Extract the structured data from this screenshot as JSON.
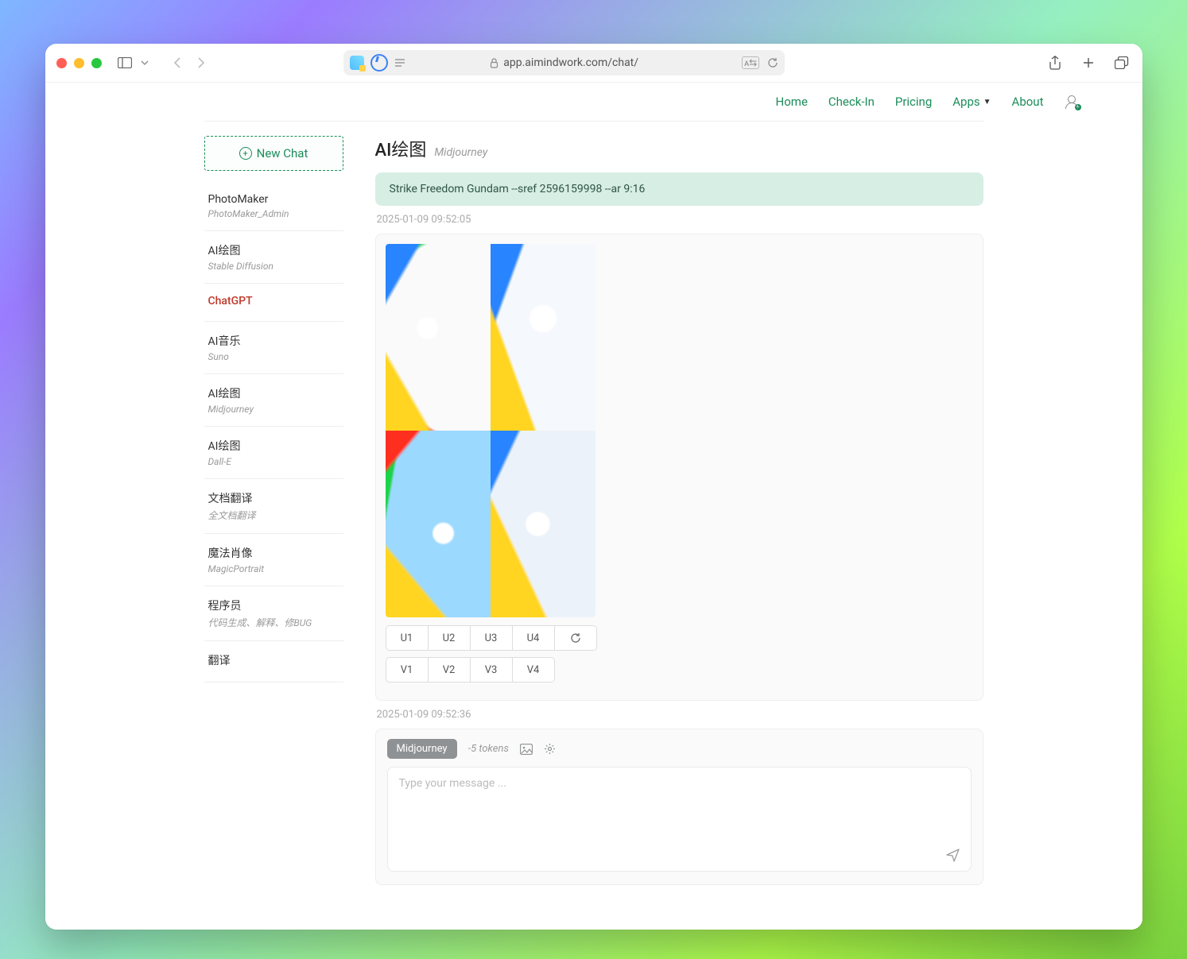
{
  "browser": {
    "url": "app.aimindwork.com/chat/"
  },
  "nav": {
    "home": "Home",
    "checkin": "Check-In",
    "pricing": "Pricing",
    "apps": "Apps",
    "about": "About"
  },
  "sidebar": {
    "new_chat": "New Chat",
    "items": [
      {
        "t": "PhotoMaker",
        "s": "PhotoMaker_Admin"
      },
      {
        "t": "AI绘图",
        "s": "Stable Diffusion"
      },
      {
        "t": "ChatGPT",
        "s": ""
      },
      {
        "t": "AI音乐",
        "s": "Suno"
      },
      {
        "t": "AI绘图",
        "s": "Midjourney"
      },
      {
        "t": "AI绘图",
        "s": "Dall-E"
      },
      {
        "t": "文档翻译",
        "s": "全文档翻译"
      },
      {
        "t": "魔法肖像",
        "s": "MagicPortrait"
      },
      {
        "t": "程序员",
        "s": "代码生成、解释、修BUG"
      },
      {
        "t": "翻译",
        "s": ""
      }
    ]
  },
  "main": {
    "title": "AI绘图",
    "subtitle": "Midjourney",
    "prompt": "Strike Freedom Gundam --sref 2596159998 --ar 9:16",
    "prompt_ts": "2025-01-09 09:52:05",
    "output_ts": "2025-01-09 09:52:36",
    "u_buttons": [
      "U1",
      "U2",
      "U3",
      "U4"
    ],
    "v_buttons": [
      "V1",
      "V2",
      "V3",
      "V4"
    ]
  },
  "composer": {
    "mode": "Midjourney",
    "tokens": "-5 tokens",
    "placeholder": "Type your message ..."
  }
}
